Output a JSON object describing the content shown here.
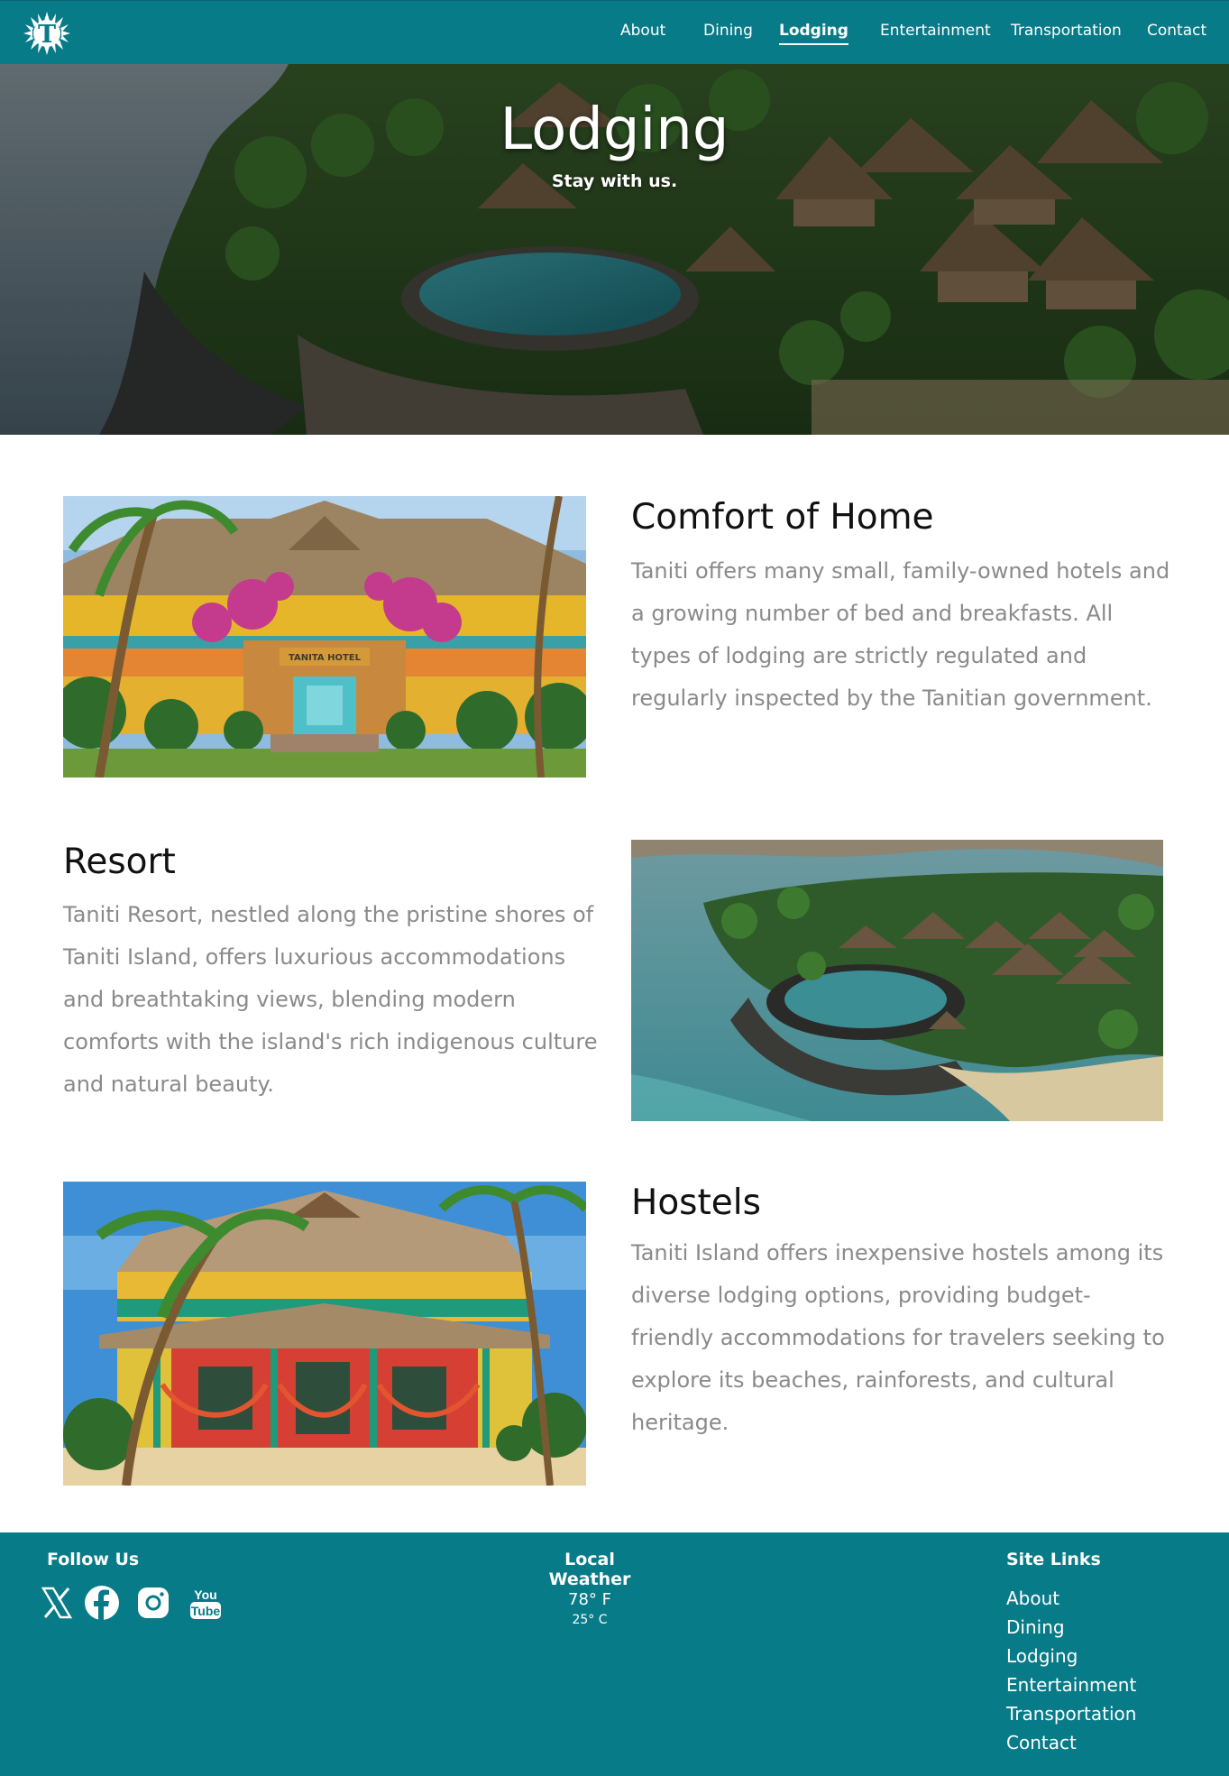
{
  "brand": {
    "logo_letter": "T",
    "colors": {
      "teal": "#087b88",
      "heading": "#111111",
      "body_text": "#8a8a8a"
    }
  },
  "nav": {
    "items": [
      {
        "label": "About"
      },
      {
        "label": "Dining"
      },
      {
        "label": "Lodging",
        "active": true
      },
      {
        "label": "Entertainment"
      },
      {
        "label": "Transportation"
      },
      {
        "label": "Contact"
      }
    ]
  },
  "hero": {
    "title": "Lodging",
    "subtitle": "Stay with us."
  },
  "sections": [
    {
      "title": "Comfort of Home",
      "text": "Taniti offers many small, family-owned hotels and a growing number of bed and breakfasts. All types of lodging are strictly regulated and regularly inspected by the Tanitian government.",
      "sign_text": "TANITA HOTEL"
    },
    {
      "title": "Resort",
      "text": "Taniti Resort, nestled along the pristine shores of Taniti Island, offers luxurious accommodations and breathtaking views, blending modern comforts with the island's rich indigenous culture and natural beauty."
    },
    {
      "title": "Hostels",
      "text": "Taniti Island offers inexpensive hostels among its diverse lodging options, providing budget-friendly accommodations for travelers seeking to explore its beaches, rainforests, and cultural heritage."
    }
  ],
  "footer": {
    "follow_heading": "Follow Us",
    "social": [
      {
        "icon": "x-icon"
      },
      {
        "icon": "facebook-icon"
      },
      {
        "icon": "instagram-icon"
      },
      {
        "icon": "youtube-icon",
        "line1": "You",
        "line2": "Tube"
      }
    ],
    "weather_heading": "Local Weather",
    "temp_f": "78° F",
    "temp_c": "25° C",
    "links_heading": "Site Links",
    "links": [
      {
        "label": "About"
      },
      {
        "label": "Dining"
      },
      {
        "label": "Lodging"
      },
      {
        "label": "Entertainment"
      },
      {
        "label": "Transportation"
      },
      {
        "label": "Contact"
      }
    ]
  }
}
